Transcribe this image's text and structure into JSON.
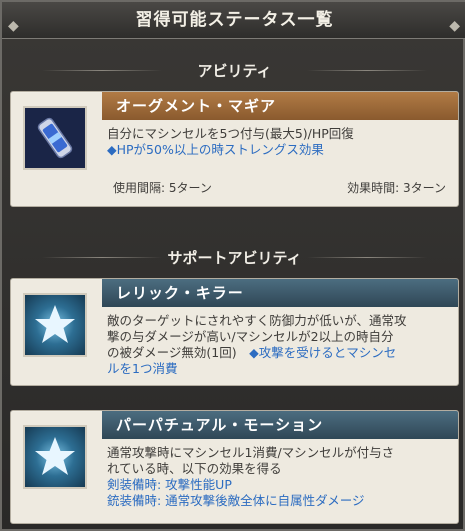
{
  "window": {
    "title": "習得可能ステータス一覧"
  },
  "sections": {
    "ability": {
      "header": "アビリティ"
    },
    "support": {
      "header": "サポートアビリティ"
    }
  },
  "cards": {
    "augment": {
      "name": "オーグメント・マギア",
      "desc_line1": "自分にマシンセルを5つ付与(最大5)/HP回復",
      "desc_line2": "◆HPが50%以上の時ストレングス効果",
      "cooldown": "使用間隔: 5ターン",
      "duration": "効果時間: 3ターン",
      "icon": "capsule-icon"
    },
    "relic": {
      "name": "レリック・キラー",
      "desc_line1": "敵のターゲットにされやすく防御力が低いが、通常攻",
      "desc_line2": "撃の与ダメージが高い/マシンセルが2以上の時自分",
      "desc_line3_a": "の被ダメージ無効(1回)　",
      "desc_line3_b": "◆攻撃を受けるとマシンセ",
      "desc_line4": "ルを1つ消費",
      "icon": "star-icon"
    },
    "perpetual": {
      "name": "パーパチュアル・モーション",
      "desc_line1": "通常攻撃時にマシンセル1消費/マシンセルが付与さ",
      "desc_line2": "れている時、以下の効果を得る",
      "desc_line3": "剣装備時: 攻撃性能UP",
      "desc_line4": "銃装備時: 通常攻撃後敵全体に自属性ダメージ",
      "icon": "star-icon"
    }
  },
  "colors": {
    "accent_blue": "#2c6cc1",
    "name_bar_orange": "#9e6a3a",
    "name_bar_blue": "#3c5a6c"
  }
}
